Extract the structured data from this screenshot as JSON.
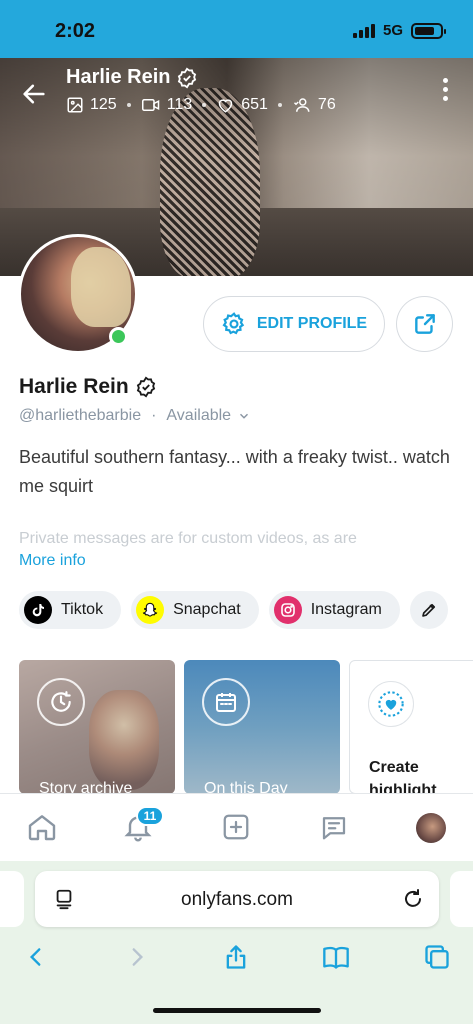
{
  "status_bar": {
    "time": "2:02",
    "network": "5G",
    "battery_level": 0.8
  },
  "header": {
    "name": "Harlie Rein",
    "stats": {
      "images": "125",
      "videos": "113",
      "likes": "651",
      "fans": "76"
    }
  },
  "profile": {
    "edit_label": "EDIT PROFILE",
    "name": "Harlie Rein",
    "handle": "@harliethebarbie",
    "availability": "Available",
    "bio": "Beautiful southern fantasy... with a freaky twist.. watch me squirt",
    "bio_faded": "Private messages are for custom videos, as are",
    "more_info": "More info"
  },
  "social_links": [
    {
      "label": "Tiktok",
      "icon": "tiktok-icon",
      "color": "#000000"
    },
    {
      "label": "Snapchat",
      "icon": "snapchat-icon",
      "color": "#fffc00"
    },
    {
      "label": "Instagram",
      "icon": "instagram-icon",
      "color": "#e1306c"
    }
  ],
  "highlights": [
    {
      "label": "Story archive",
      "icon": "clock-icon"
    },
    {
      "label": "On this Day",
      "icon": "calendar-icon"
    },
    {
      "label": "Create highlight",
      "icon": "heart-icon"
    }
  ],
  "bottom_nav": {
    "notifications_badge": "11"
  },
  "browser": {
    "url": "onlyfans.com"
  },
  "colors": {
    "accent": "#1aa2dc",
    "status_bar": "#24a8dc",
    "online": "#3cc75a"
  }
}
